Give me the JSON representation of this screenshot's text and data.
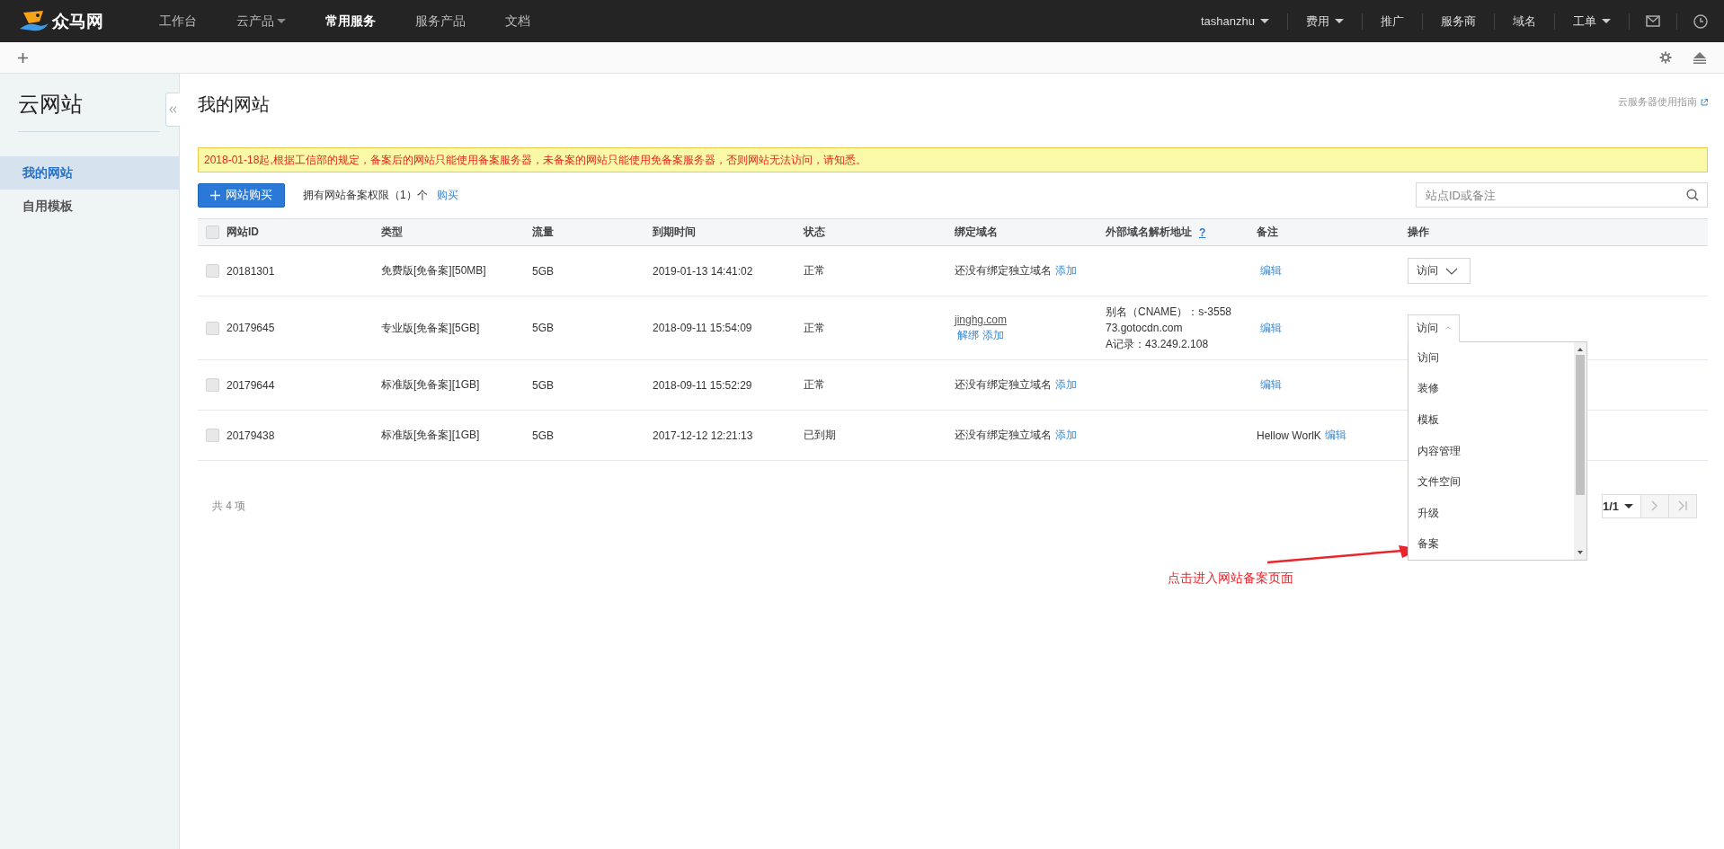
{
  "topbar": {
    "logo_text": "众马网",
    "nav": [
      {
        "label": "工作台",
        "selected": false,
        "has_caret": false
      },
      {
        "label": "云产品",
        "selected": false,
        "has_caret": true
      },
      {
        "label": "常用服务",
        "selected": true,
        "has_caret": false
      },
      {
        "label": "服务产品",
        "selected": false,
        "has_caret": false
      },
      {
        "label": "文档",
        "selected": false,
        "has_caret": false
      }
    ],
    "right_menu": [
      {
        "label": "tashanzhu",
        "has_caret": true
      },
      {
        "label": "费用",
        "has_caret": true
      },
      {
        "label": "推广",
        "has_caret": false
      },
      {
        "label": "服务商",
        "has_caret": false
      },
      {
        "label": "域名",
        "has_caret": false
      },
      {
        "label": "工单",
        "has_caret": true
      }
    ]
  },
  "sidebar": {
    "title": "云网站",
    "items": [
      {
        "label": "我的网站",
        "selected": true
      },
      {
        "label": "自用模板",
        "selected": false
      }
    ]
  },
  "page": {
    "title": "我的网站",
    "guide_link": "云服务器使用指南",
    "notice": "2018-01-18起,根据工信部的规定，备案后的网站只能使用备案服务器，未备案的网站只能使用免备案服务器，否则网站无法访问，请知悉。",
    "buy_button": "网站购买",
    "quota_text": "拥有网站备案权限（1）个",
    "quota_link": "购买",
    "search": {
      "placeholder": "站点ID或备注"
    }
  },
  "table": {
    "select_all_checked": false,
    "columns": [
      {
        "label": "网站ID"
      },
      {
        "label": "类型"
      },
      {
        "label": "流量"
      },
      {
        "label": "到期时间"
      },
      {
        "label": "状态"
      },
      {
        "label": "绑定域名"
      },
      {
        "label": "外部域名解析地址",
        "help": "?"
      },
      {
        "label": "备注"
      },
      {
        "label": "操作"
      }
    ],
    "rows": [
      {
        "checked": false,
        "id": "20181301",
        "type": "免费版[免备案][50MB]",
        "traffic": "5GB",
        "expires": "2019-01-13 14:41:02",
        "status": "正常",
        "domain": {
          "kind": "none",
          "text": "还没有绑定独立域名",
          "links": [
            "添加"
          ]
        },
        "note": {
          "link": "编辑"
        },
        "action": {
          "label": "访问",
          "expanded": false
        }
      },
      {
        "checked": false,
        "id": "20179645",
        "type": "专业版[免备案][5GB]",
        "traffic": "5GB",
        "expires": "2018-09-11 15:54:09",
        "status": "正常",
        "domain": {
          "kind": "bound",
          "text": "jinghg.com",
          "links": [
            "解绑",
            "添加"
          ]
        },
        "external": [
          "别名（CNAME）：s-3558",
          "73.gotocdn.com",
          "A记录：43.249.2.108"
        ],
        "note": {
          "link": "编辑"
        },
        "action": {
          "label": "访问",
          "expanded": true
        }
      },
      {
        "checked": false,
        "id": "20179644",
        "type": "标准版[免备案][1GB]",
        "traffic": "5GB",
        "expires": "2018-09-11 15:52:29",
        "status": "正常",
        "domain": {
          "kind": "none",
          "text": "还没有绑定独立域名",
          "links": [
            "添加"
          ]
        },
        "note": {
          "link": "编辑"
        }
      },
      {
        "checked": false,
        "id": "20179438",
        "type": "标准版[免备案][1GB]",
        "traffic": "5GB",
        "expires": "2017-12-12 12:21:13",
        "status": "已到期",
        "domain": {
          "kind": "none",
          "text": "还没有绑定独立域名",
          "links": [
            "添加"
          ]
        },
        "note": {
          "text": "Hellow WorlK",
          "link": "编辑"
        }
      }
    ]
  },
  "dropdown": {
    "items": [
      "访问",
      "装修",
      "模板",
      "内容管理",
      "文件空间",
      "升级",
      "备案"
    ]
  },
  "footer": {
    "total": "共 4 项",
    "page": "1/1"
  },
  "annotation": {
    "text": "点击进入网站备案页面"
  }
}
